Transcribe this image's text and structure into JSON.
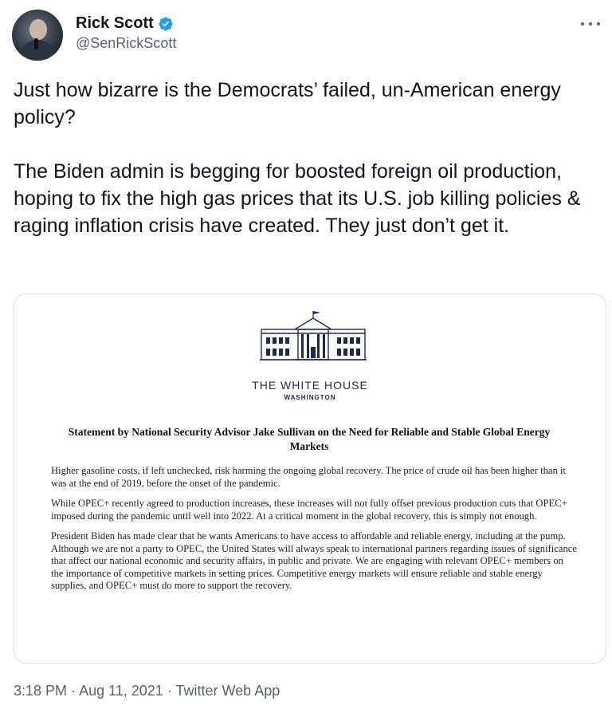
{
  "author": {
    "display_name": "Rick Scott",
    "handle": "@SenRickScott"
  },
  "tweet": {
    "paragraphs": [
      "Just how bizarre is the Democrats’ failed, un-American energy policy?",
      "The Biden admin is begging for boosted foreign oil production, hoping to fix the high gas prices that its U.S. job killing policies & raging inflation crisis have created. They just don’t get it."
    ]
  },
  "image_card": {
    "org_title": "THE WHITE HOUSE",
    "org_subtitle": "WASHINGTON",
    "statement_title": "Statement by National Security Advisor Jake Sullivan on the Need for Reliable and Stable Global Energy Markets",
    "paragraphs": [
      "Higher gasoline costs, if left unchecked, risk harming the ongoing global recovery. The price of crude oil has been higher than it was at the end of 2019, before the onset of the pandemic.",
      "While OPEC+ recently agreed to production increases, these increases will not fully offset previous production cuts that OPEC+ imposed during the pandemic until well into 2022. At a critical moment in the global recovery, this is simply not enough.",
      "President Biden has made clear that he wants Americans to have access to affordable and reliable energy, including at the pump. Although we are not a party to OPEC, the United States will always speak to international partners regarding issues of significance that affect our national economic and security affairs, in public and private. We are engaging with relevant OPEC+ members on the importance of competitive markets in setting prices. Competitive energy markets will ensure reliable and stable energy supplies, and OPEC+ must do more to support the recovery."
    ]
  },
  "meta": {
    "time": "3:18 PM",
    "date": "Aug 11, 2021",
    "source": "Twitter Web App",
    "separator": " · "
  },
  "colors": {
    "verified": "#1d9bf0",
    "secondary_text": "#536471",
    "whitehouse_navy": "#1d2a4d"
  },
  "icons": {
    "verified": "verified-badge-icon",
    "more": "more-dots-icon",
    "logo": "white-house-logo"
  }
}
